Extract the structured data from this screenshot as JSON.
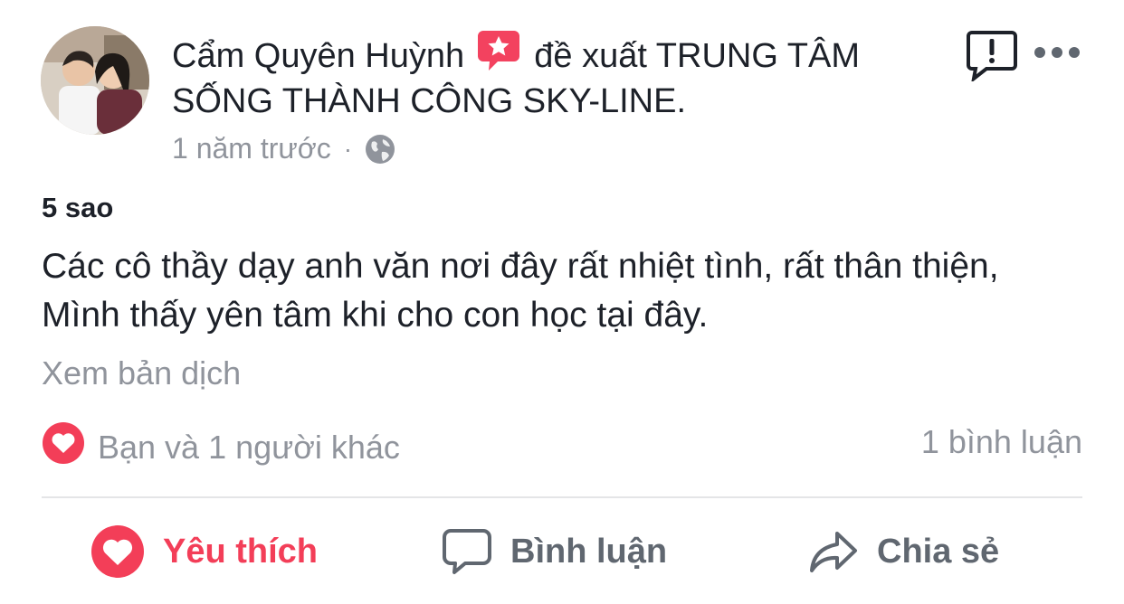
{
  "post": {
    "author": "Cẩm Quyên Huỳnh",
    "recommends_text": "đề xuất TRUNG TÂM SỐNG THÀNH CÔNG SKY-LINE.",
    "time": "1 năm trước",
    "separator": "·",
    "rating": "5 sao",
    "review": "Các cô thầy dạy anh văn nơi đây rất nhiệt tình, rất thân thiện, Mình thấy yên tâm khi cho con học tại đây.",
    "translate_link": "Xem bản dịch",
    "reactions_text": "Bạn và 1 người khác",
    "comments_count": "1 bình luận"
  },
  "actions": {
    "like_label": "Yêu thích",
    "comment_label": "Bình luận",
    "share_label": "Chia sẻ"
  },
  "icons": {
    "avatar": "avatar-photo",
    "badge": "recommend-star-icon",
    "privacy": "globe-icon",
    "report": "report-icon",
    "more": "more-options-icon",
    "reaction": "love-reaction-icon",
    "like": "heart-icon",
    "comment": "comment-bubble-icon",
    "share": "share-arrow-icon"
  },
  "colors": {
    "accent_love": "#f33e58",
    "text_primary": "#1d2129",
    "text_secondary": "#90949c",
    "action_gray": "#606770",
    "divider": "#e4e5e7"
  }
}
